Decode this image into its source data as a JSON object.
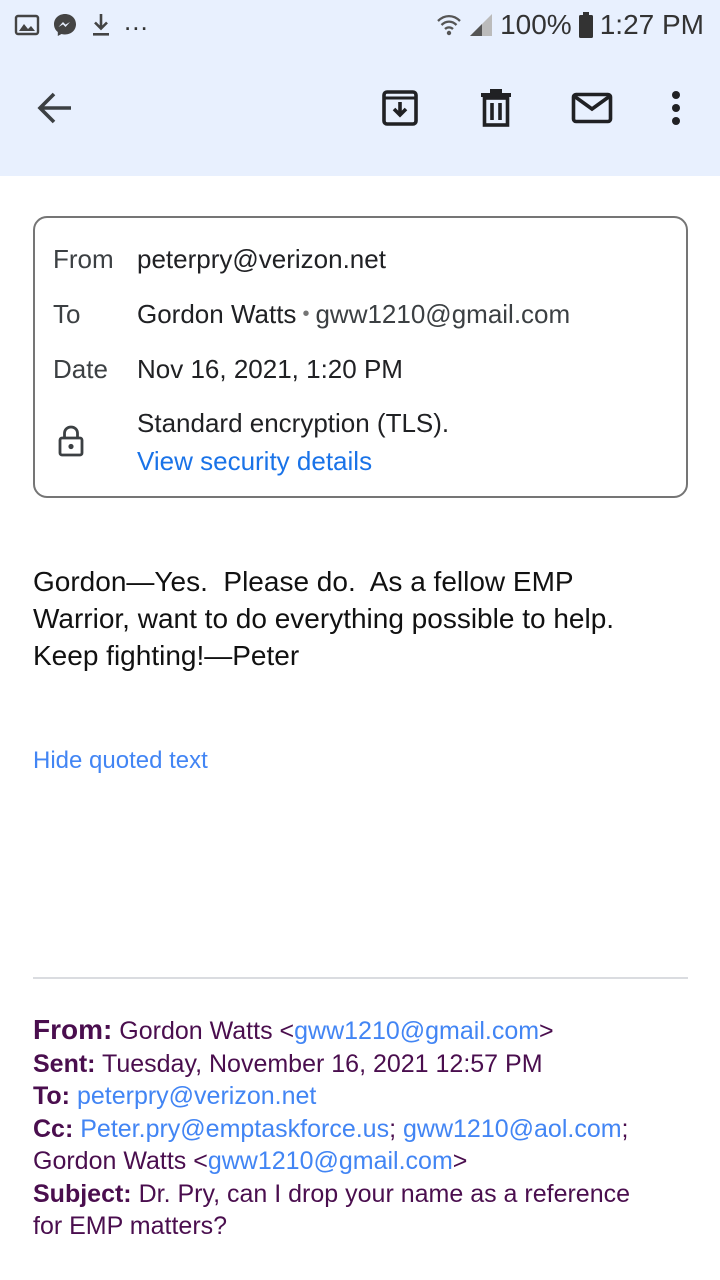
{
  "status_bar": {
    "battery": "100%",
    "time": "1:27 PM",
    "dots": "..."
  },
  "toolbar": {
    "icons": [
      "back-arrow-icon",
      "archive-icon",
      "delete-icon",
      "mark-unread-icon",
      "more-vert-icon"
    ]
  },
  "details": {
    "from_label": "From",
    "from_value": "peterpry@verizon.net",
    "to_label": "To",
    "to_name": "Gordon Watts",
    "to_separator": "•",
    "to_email": "gww1210@gmail.com",
    "date_label": "Date",
    "date_value": "Nov 16, 2021, 1:20 PM",
    "encryption_text": "Standard encryption (TLS).",
    "security_link": "View security details"
  },
  "message": {
    "line1": "Gordon—Yes.  Please do.  As a fellow EMP",
    "line2": "Warrior, want to do everything possible to help.",
    "line3": "Keep fighting!—Peter",
    "hide_quoted": "Hide quoted text"
  },
  "quoted": {
    "from_label": "From:",
    "from_name": "Gordon Watts <",
    "from_email": "gww1210@gmail.com",
    "from_close": ">",
    "sent_label": "Sent:",
    "sent_value": "Tuesday, November 16, 2021 12:57 PM",
    "to_label": "To:",
    "to_email": "peterpry@verizon.net",
    "cc_label": "Cc:",
    "cc_email1": "Peter.pry@emptaskforce.us",
    "cc_sep1": ";",
    "cc_email2": "gww1210@aol.com",
    "cc_sep2": ";",
    "cc_name": "Gordon Watts <",
    "cc_email3": "gww1210@gmail.com",
    "cc_close": ">",
    "subject_label": "Subject:",
    "subject_line1": "Dr. Pry, can I drop your name as a reference",
    "subject_line2": "for EMP matters?"
  }
}
